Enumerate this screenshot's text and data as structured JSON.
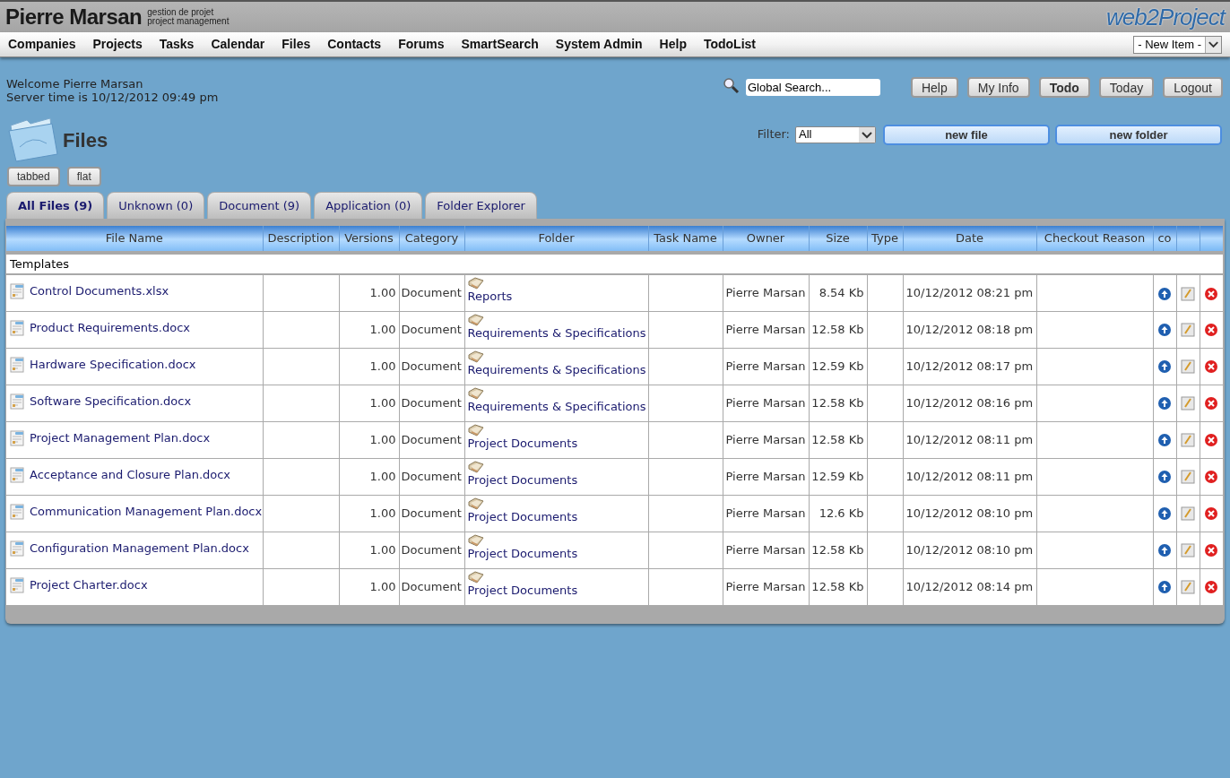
{
  "header": {
    "title": "Pierre Marsan",
    "subtitle_lines": [
      "gestion de projet",
      "project management"
    ],
    "logo": "web2Project"
  },
  "nav": {
    "items": [
      "Companies",
      "Projects",
      "Tasks",
      "Calendar",
      "Files",
      "Contacts",
      "Forums",
      "SmartSearch",
      "System Admin",
      "Help",
      "TodoList"
    ],
    "new_item_select": "- New Item -"
  },
  "welcome": {
    "greeting": "Welcome Pierre Marsan",
    "server_time": "Server time is 10/12/2012 09:49 pm"
  },
  "search": {
    "value": "Global Search..."
  },
  "top_buttons": [
    {
      "label": "Help",
      "selected": false
    },
    {
      "label": "My Info",
      "selected": false
    },
    {
      "label": "Todo",
      "selected": true
    },
    {
      "label": "Today",
      "selected": false
    },
    {
      "label": "Logout",
      "selected": false
    }
  ],
  "page": {
    "title": "Files",
    "filter_label": "Filter:",
    "filter_value": "All",
    "actions": [
      "new file",
      "new folder"
    ]
  },
  "view_buttons": [
    "tabbed",
    "flat"
  ],
  "tabs": [
    {
      "label": "All Files (9)",
      "selected": true
    },
    {
      "label": "Unknown (0)",
      "selected": false
    },
    {
      "label": "Document (9)",
      "selected": false
    },
    {
      "label": "Application (0)",
      "selected": false
    },
    {
      "label": "Folder Explorer",
      "selected": false
    }
  ],
  "table": {
    "columns": [
      "File Name",
      "Description",
      "Versions",
      "Category",
      "Folder",
      "Task Name",
      "Owner",
      "Size",
      "Type",
      "Date",
      "Checkout Reason",
      "co"
    ],
    "group": "Templates",
    "rows": [
      {
        "file_name": "Control Documents.xlsx",
        "version": "1.00",
        "category": "Document",
        "folder": "Reports",
        "owner": "Pierre Marsan",
        "size": "8.54 Kb",
        "date": "10/12/2012 08:21 pm"
      },
      {
        "file_name": "Product Requirements.docx",
        "version": "1.00",
        "category": "Document",
        "folder": "Requirements & Specifications",
        "owner": "Pierre Marsan",
        "size": "12.58 Kb",
        "date": "10/12/2012 08:18 pm"
      },
      {
        "file_name": "Hardware Specification.docx",
        "version": "1.00",
        "category": "Document",
        "folder": "Requirements & Specifications",
        "owner": "Pierre Marsan",
        "size": "12.59 Kb",
        "date": "10/12/2012 08:17 pm"
      },
      {
        "file_name": "Software Specification.docx",
        "version": "1.00",
        "category": "Document",
        "folder": "Requirements & Specifications",
        "owner": "Pierre Marsan",
        "size": "12.58 Kb",
        "date": "10/12/2012 08:16 pm"
      },
      {
        "file_name": "Project Management Plan.docx",
        "version": "1.00",
        "category": "Document",
        "folder": "Project Documents",
        "owner": "Pierre Marsan",
        "size": "12.58 Kb",
        "date": "10/12/2012 08:11 pm"
      },
      {
        "file_name": "Acceptance and Closure Plan.docx",
        "version": "1.00",
        "category": "Document",
        "folder": "Project Documents",
        "owner": "Pierre Marsan",
        "size": "12.59 Kb",
        "date": "10/12/2012 08:11 pm"
      },
      {
        "file_name": "Communication Management Plan.docx",
        "version": "1.00",
        "category": "Document",
        "folder": "Project Documents",
        "owner": "Pierre Marsan",
        "size": "12.6 Kb",
        "date": "10/12/2012 08:10 pm"
      },
      {
        "file_name": "Configuration Management Plan.docx",
        "version": "1.00",
        "category": "Document",
        "folder": "Project Documents",
        "owner": "Pierre Marsan",
        "size": "12.58 Kb",
        "date": "10/12/2012 08:10 pm"
      },
      {
        "file_name": "Project Charter.docx",
        "version": "1.00",
        "category": "Document",
        "folder": "Project Documents",
        "owner": "Pierre Marsan",
        "size": "12.58 Kb",
        "date": "10/12/2012 08:14 pm"
      }
    ]
  }
}
